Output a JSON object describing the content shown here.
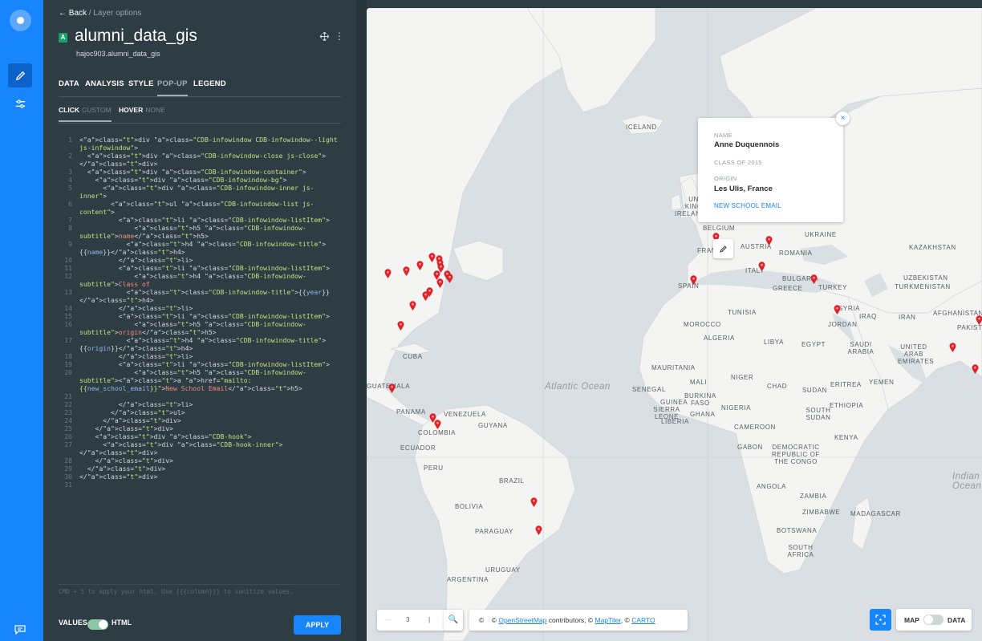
{
  "nav": {
    "back_label": "Back",
    "breadcrumb": "/ Layer options"
  },
  "layer": {
    "badge": "A",
    "name": "alumni_data_gis",
    "table": "hajoc903.alumni_data_gis",
    "more_icon": "⋮"
  },
  "tabs": [
    "DATA",
    "ANALYSIS",
    "STYLE",
    "POP-UP",
    "LEGEND"
  ],
  "selected_tab": "POP-UP",
  "subtabs": {
    "click_label": "CLICK",
    "click_mode": "CUSTOM",
    "hover_label": "HOVER",
    "hover_mode": "NONE"
  },
  "code_lines": [
    "<div class=\"CDB-infowindow CDB-infowindow--light js-infowindow\">",
    "  <div class=\"CDB-infowindow-close js-close\"></div>",
    "  <div class=\"CDB-infowindow-container\">",
    "    <div class=\"CDB-infowindow-bg\">",
    "      <div class=\"CDB-infowindow-inner js-inner\">",
    "        <ul class=\"CDB-infowindow-list js-content\">",
    "          <li class=\"CDB-infowindow-listItem\">",
    "              <h5 class=\"CDB-infowindow-subtitle\">name</h5>",
    "            <h4 class=\"CDB-infowindow-title\">{{name}}</h4>",
    "          </li>",
    "          <li class=\"CDB-infowindow-listItem\">",
    "              <h4 class=\"CDB-infowindow-subtitle\">Class of",
    "            <class=\"CDB-infowindow-title\">{{year}}</h4>",
    "          </li>",
    "          <li class=\"CDB-infowindow-listItem\">",
    "              <h5 class=\"CDB-infowindow-subtitle\">origin</h5>",
    "            <h4 class=\"CDB-infowindow-title\">{{origin}}</h4>",
    "          </li>",
    "          <li class=\"CDB-infowindow-listItem\">",
    "              <h5 class=\"CDB-infowindow-subtitle\"><a href=\"mailto:{{new_school_email}}\">New School Email</h5>",
    "",
    "          </li>",
    "        </ul>",
    "      </div>",
    "    </div>",
    "    <div class=\"CDB-hook\">",
    "      <div class=\"CDB-hook-inner\"></div>",
    "    </div>",
    "  </div>",
    "</div>",
    ""
  ],
  "editor_hint": "CMD + S to apply your html. Use {{{column}}} to sanitize values.",
  "footer": {
    "values_label": "VALUES",
    "html_label": "HTML",
    "html_enabled": true,
    "apply_label": "APPLY"
  },
  "popup": {
    "name_label": "NAME",
    "name_value": "Anne Duquennois",
    "class_label": "CLASS OF 2015",
    "origin_label": "ORIGIN",
    "origin_value": "Les Ulis, France",
    "link_label": "NEW SCHOOL EMAIL",
    "close_icon": "×"
  },
  "map_labels": [
    "ICELAND",
    "UNITED KINGDOM",
    "IRELAND",
    "BELGIUM",
    "FRANCE",
    "UKRAINE",
    "AUSTRIA",
    "ROMANIA",
    "ITALY",
    "BULGARIA",
    "GREECE",
    "TURKEY",
    "SPAIN",
    "KAZAKHSTAN",
    "UZBEKISTAN",
    "TURKMENISTAN",
    "SYRIA",
    "IRAQ",
    "IRAN",
    "AFGHANISTAN",
    "PAKISTAN",
    "JORDAN",
    "TUNISIA",
    "MOROCCO",
    "ALGERIA",
    "LIBYA",
    "EGYPT",
    "SAUDI ARABIA",
    "UNITED ARAB EMIRATES",
    "YEMEN",
    "ERITREA",
    "SUDAN",
    "CHAD",
    "NIGER",
    "MALI",
    "MAURITANIA",
    "SENEGAL",
    "BURKINA FASO",
    "GUINEA",
    "SIERRA LEONE",
    "LIBERIA",
    "GHANA",
    "NIGERIA",
    "CAMEROON",
    "ETHIOPIA",
    "SOUTH SUDAN",
    "KENYA",
    "GABON",
    "DEMOCRATIC REPUBLIC OF THE CONGO",
    "ANGOLA",
    "ZAMBIA",
    "ZIMBABWE",
    "MADAGASCAR",
    "BOTSWANA",
    "SOUTH AFRICA",
    "CUBA",
    "GUATEMALA",
    "PANAMA",
    "VENEZUELA",
    "GUYANA",
    "COLOMBIA",
    "ECUADOR",
    "PERU",
    "BRAZIL",
    "BOLIVIA",
    "PARAGUAY",
    "URUGUAY",
    "ARGENTINA"
  ],
  "oceans": {
    "atlantic": "Atlantic Ocean",
    "indian": "Indian Ocean"
  },
  "map_controls": {
    "zoom_level": "3",
    "search_icon": "search-icon",
    "attribution_prefix": "©",
    "attribution_osm": "OpenStreetMap",
    "attribution_mid": "contributors, ©",
    "attribution_maptiler": "MapTiler",
    "attribution_sep": ", ©",
    "attribution_carto": "CARTO",
    "map_label": "MAP",
    "data_label": "DATA"
  },
  "colors": {
    "accent": "#1785fb",
    "panel_bg": "#2e3c43",
    "pin": "#e0232b",
    "land": "#f4f4f2",
    "water": "#d9dfe3"
  }
}
